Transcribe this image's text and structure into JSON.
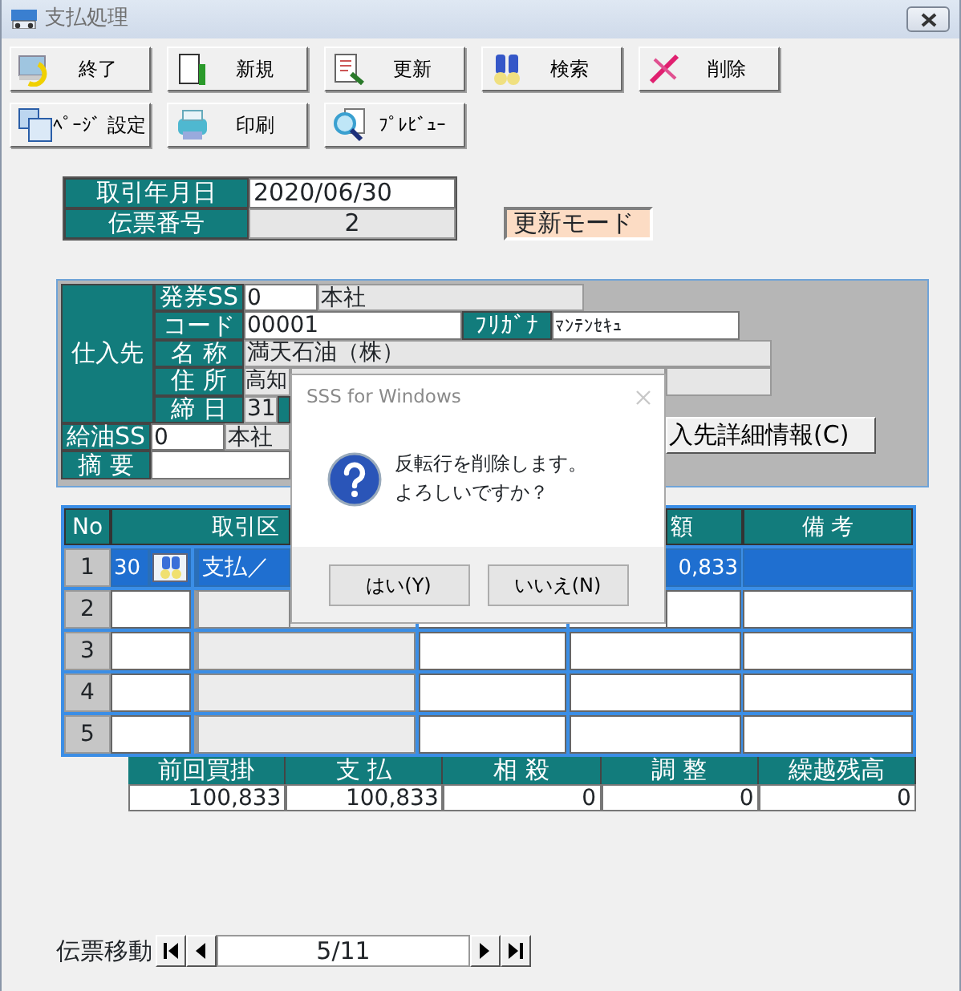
{
  "window": {
    "title": "支払処理"
  },
  "toolbar": [
    [
      "終了",
      "新規",
      "更新",
      "検索",
      "削除"
    ],
    [
      "ﾍﾟｰｼﾞ 設定",
      "印刷",
      "ﾌﾟﾚﾋﾞｭｰ"
    ]
  ],
  "header_fields": [
    {
      "label": "取引年月日",
      "value": "2020/06/30",
      "editable": true
    },
    {
      "label": "伝票番号",
      "value": "2",
      "editable": false
    }
  ],
  "mode_badge": "更新モード",
  "supplier": {
    "group_label": "仕入先",
    "issuing_ss": {
      "label": "発券SS",
      "code": "0",
      "name": "本社"
    },
    "code": {
      "label": "コード",
      "value": "00001"
    },
    "furigana": {
      "label": "ﾌﾘｶﾞﾅ",
      "value": "ﾏﾝﾃﾝｾｷｭ"
    },
    "name": {
      "label": "名 称",
      "value": "満天石油（株）"
    },
    "address": {
      "label": "住 所",
      "value": "高知"
    },
    "closing_day": {
      "label": "締 日",
      "value": "31"
    },
    "fuel_ss": {
      "label": "給油SS",
      "code": "0",
      "name": "本社"
    },
    "summary": {
      "label": "摘 要"
    },
    "detail_button": "入先詳細情報(C)"
  },
  "grid": {
    "columns": [
      "No",
      "取引区",
      "額",
      "備 考"
    ],
    "rows": [
      {
        "no": "1",
        "selected": true,
        "code": "30",
        "type": "支払／",
        "amount": "0,833"
      },
      {
        "no": "2",
        "selected": false
      },
      {
        "no": "3",
        "selected": false
      },
      {
        "no": "4",
        "selected": false
      },
      {
        "no": "5",
        "selected": false
      }
    ]
  },
  "totals": [
    {
      "label": "前回買掛",
      "value": "100,833"
    },
    {
      "label": "支 払",
      "value": "100,833"
    },
    {
      "label": "相 殺",
      "value": "0"
    },
    {
      "label": "調 整",
      "value": "0"
    },
    {
      "label": "繰越残高",
      "value": "0"
    }
  ],
  "navigator": {
    "label": "伝票移動",
    "value": "5/11"
  },
  "dialog": {
    "title": "SSS for Windows",
    "message": [
      "反転行を削除します。",
      "よろしいですか？"
    ],
    "buttons": [
      "はい(Y)",
      "いいえ(N)"
    ]
  }
}
